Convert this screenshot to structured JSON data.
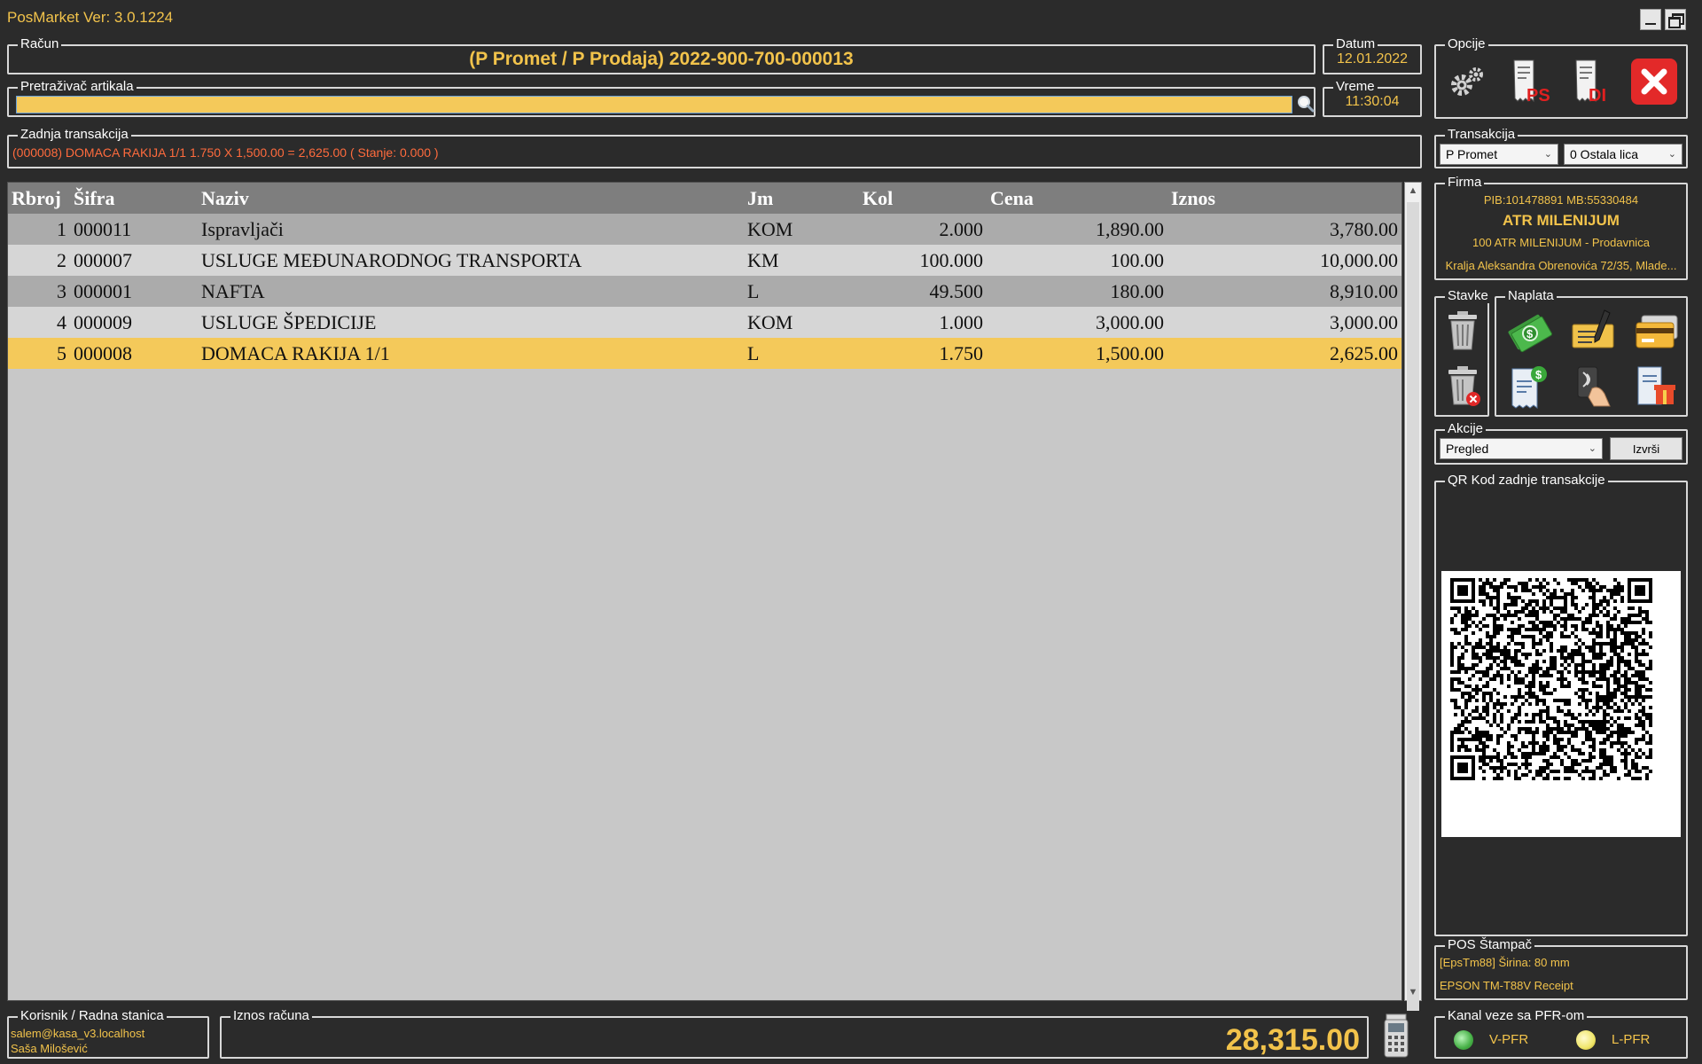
{
  "window": {
    "title": "PosMarket Ver: 3.0.1224"
  },
  "racun": {
    "legend": "Račun",
    "value": "(P Promet / P Prodaja) 2022-900-700-000013"
  },
  "datum": {
    "legend": "Datum",
    "value": "12.01.2022"
  },
  "vreme": {
    "legend": "Vreme",
    "value": "11:30:04"
  },
  "search": {
    "legend": "Pretraživač artikala",
    "value": ""
  },
  "zadnja": {
    "legend": "Zadnja transakcija",
    "value": "(000008) DOMACA RAKIJA 1/1 1.750 X 1,500.00 = 2,625.00 ( Stanje: 0.000 )"
  },
  "opcije": {
    "legend": "Opcije"
  },
  "transakcija": {
    "legend": "Transakcija",
    "type": "P Promet",
    "party": "0 Ostala lica"
  },
  "firma": {
    "legend": "Firma",
    "pib": "PIB:101478891 MB:55330484",
    "name": "ATR MILENIJUM",
    "store": "100 ATR MILENIJUM - Prodavnica",
    "address": "Kralja Aleksandra Obrenovića 72/35, Mlade..."
  },
  "stavke": {
    "legend": "Stavke"
  },
  "naplata": {
    "legend": "Naplata"
  },
  "akcije": {
    "legend": "Akcije",
    "selected": "Pregled",
    "button": "Izvrši"
  },
  "qr": {
    "legend": "QR Kod zadnje transakcije"
  },
  "printer": {
    "legend": "POS Štampač",
    "line1": "[EpsTm88] Širina: 80 mm",
    "line2": "EPSON TM-T88V Receipt"
  },
  "kanal": {
    "legend": "Kanal veze sa PFR-om",
    "v": "V-PFR",
    "l": "L-PFR"
  },
  "korisnik": {
    "legend": "Korisnik / Radna stanica",
    "email": "salem@kasa_v3.localhost",
    "name": "Saša Milošević"
  },
  "iznos": {
    "legend": "Iznos računa",
    "value": "28,315.00"
  },
  "table": {
    "headers": {
      "rbroj": "Rbroj",
      "sifra": "Šifra",
      "naziv": "Naziv",
      "jm": "Jm",
      "kol": "Kol",
      "cena": "Cena",
      "iznos": "Iznos"
    },
    "rows": [
      {
        "rbroj": "1",
        "sifra": "000011",
        "naziv": "Ispravljači",
        "jm": "KOM",
        "kol": "2.000",
        "cena": "1,890.00",
        "iznos": "3,780.00"
      },
      {
        "rbroj": "2",
        "sifra": "000007",
        "naziv": "USLUGE MEĐUNARODNOG TRANSPORTA",
        "jm": "KM",
        "kol": "100.000",
        "cena": "100.00",
        "iznos": "10,000.00"
      },
      {
        "rbroj": "3",
        "sifra": "000001",
        "naziv": "NAFTA",
        "jm": "L",
        "kol": "49.500",
        "cena": "180.00",
        "iznos": "8,910.00"
      },
      {
        "rbroj": "4",
        "sifra": "000009",
        "naziv": "USLUGE ŠPEDICIJE",
        "jm": "KOM",
        "kol": "1.000",
        "cena": "3,000.00",
        "iznos": "3,000.00"
      },
      {
        "rbroj": "5",
        "sifra": "000008",
        "naziv": "DOMACA RAKIJA 1/1",
        "jm": "L",
        "kol": "1.750",
        "cena": "1,500.00",
        "iznos": "2,625.00"
      }
    ]
  },
  "colors": {
    "accent": "#f2c34b",
    "selectedRow": "#f4c95a",
    "warning": "#ff6b3d",
    "background": "#2b2b2b"
  }
}
